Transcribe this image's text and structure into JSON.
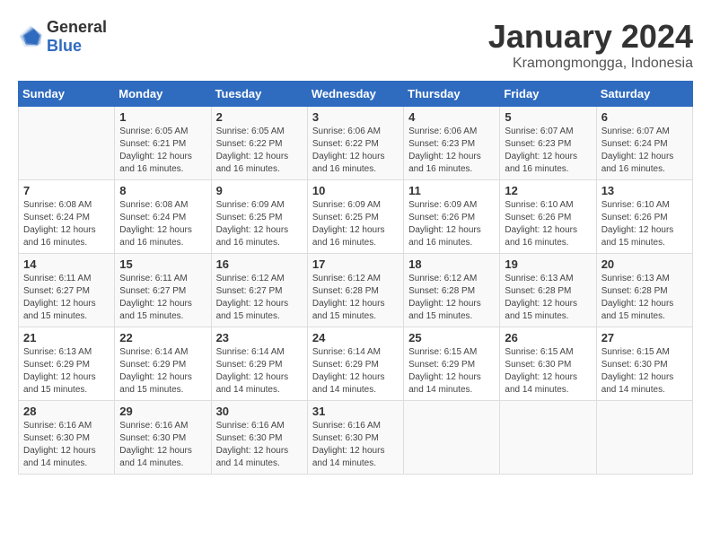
{
  "header": {
    "logo_general": "General",
    "logo_blue": "Blue",
    "month_year": "January 2024",
    "location": "Kramongmongga, Indonesia"
  },
  "weekdays": [
    "Sunday",
    "Monday",
    "Tuesday",
    "Wednesday",
    "Thursday",
    "Friday",
    "Saturday"
  ],
  "weeks": [
    [
      {
        "day": "",
        "info": ""
      },
      {
        "day": "1",
        "info": "Sunrise: 6:05 AM\nSunset: 6:21 PM\nDaylight: 12 hours\nand 16 minutes."
      },
      {
        "day": "2",
        "info": "Sunrise: 6:05 AM\nSunset: 6:22 PM\nDaylight: 12 hours\nand 16 minutes."
      },
      {
        "day": "3",
        "info": "Sunrise: 6:06 AM\nSunset: 6:22 PM\nDaylight: 12 hours\nand 16 minutes."
      },
      {
        "day": "4",
        "info": "Sunrise: 6:06 AM\nSunset: 6:23 PM\nDaylight: 12 hours\nand 16 minutes."
      },
      {
        "day": "5",
        "info": "Sunrise: 6:07 AM\nSunset: 6:23 PM\nDaylight: 12 hours\nand 16 minutes."
      },
      {
        "day": "6",
        "info": "Sunrise: 6:07 AM\nSunset: 6:24 PM\nDaylight: 12 hours\nand 16 minutes."
      }
    ],
    [
      {
        "day": "7",
        "info": "Sunrise: 6:08 AM\nSunset: 6:24 PM\nDaylight: 12 hours\nand 16 minutes."
      },
      {
        "day": "8",
        "info": "Sunrise: 6:08 AM\nSunset: 6:24 PM\nDaylight: 12 hours\nand 16 minutes."
      },
      {
        "day": "9",
        "info": "Sunrise: 6:09 AM\nSunset: 6:25 PM\nDaylight: 12 hours\nand 16 minutes."
      },
      {
        "day": "10",
        "info": "Sunrise: 6:09 AM\nSunset: 6:25 PM\nDaylight: 12 hours\nand 16 minutes."
      },
      {
        "day": "11",
        "info": "Sunrise: 6:09 AM\nSunset: 6:26 PM\nDaylight: 12 hours\nand 16 minutes."
      },
      {
        "day": "12",
        "info": "Sunrise: 6:10 AM\nSunset: 6:26 PM\nDaylight: 12 hours\nand 16 minutes."
      },
      {
        "day": "13",
        "info": "Sunrise: 6:10 AM\nSunset: 6:26 PM\nDaylight: 12 hours\nand 15 minutes."
      }
    ],
    [
      {
        "day": "14",
        "info": "Sunrise: 6:11 AM\nSunset: 6:27 PM\nDaylight: 12 hours\nand 15 minutes."
      },
      {
        "day": "15",
        "info": "Sunrise: 6:11 AM\nSunset: 6:27 PM\nDaylight: 12 hours\nand 15 minutes."
      },
      {
        "day": "16",
        "info": "Sunrise: 6:12 AM\nSunset: 6:27 PM\nDaylight: 12 hours\nand 15 minutes."
      },
      {
        "day": "17",
        "info": "Sunrise: 6:12 AM\nSunset: 6:28 PM\nDaylight: 12 hours\nand 15 minutes."
      },
      {
        "day": "18",
        "info": "Sunrise: 6:12 AM\nSunset: 6:28 PM\nDaylight: 12 hours\nand 15 minutes."
      },
      {
        "day": "19",
        "info": "Sunrise: 6:13 AM\nSunset: 6:28 PM\nDaylight: 12 hours\nand 15 minutes."
      },
      {
        "day": "20",
        "info": "Sunrise: 6:13 AM\nSunset: 6:28 PM\nDaylight: 12 hours\nand 15 minutes."
      }
    ],
    [
      {
        "day": "21",
        "info": "Sunrise: 6:13 AM\nSunset: 6:29 PM\nDaylight: 12 hours\nand 15 minutes."
      },
      {
        "day": "22",
        "info": "Sunrise: 6:14 AM\nSunset: 6:29 PM\nDaylight: 12 hours\nand 15 minutes."
      },
      {
        "day": "23",
        "info": "Sunrise: 6:14 AM\nSunset: 6:29 PM\nDaylight: 12 hours\nand 14 minutes."
      },
      {
        "day": "24",
        "info": "Sunrise: 6:14 AM\nSunset: 6:29 PM\nDaylight: 12 hours\nand 14 minutes."
      },
      {
        "day": "25",
        "info": "Sunrise: 6:15 AM\nSunset: 6:29 PM\nDaylight: 12 hours\nand 14 minutes."
      },
      {
        "day": "26",
        "info": "Sunrise: 6:15 AM\nSunset: 6:30 PM\nDaylight: 12 hours\nand 14 minutes."
      },
      {
        "day": "27",
        "info": "Sunrise: 6:15 AM\nSunset: 6:30 PM\nDaylight: 12 hours\nand 14 minutes."
      }
    ],
    [
      {
        "day": "28",
        "info": "Sunrise: 6:16 AM\nSunset: 6:30 PM\nDaylight: 12 hours\nand 14 minutes."
      },
      {
        "day": "29",
        "info": "Sunrise: 6:16 AM\nSunset: 6:30 PM\nDaylight: 12 hours\nand 14 minutes."
      },
      {
        "day": "30",
        "info": "Sunrise: 6:16 AM\nSunset: 6:30 PM\nDaylight: 12 hours\nand 14 minutes."
      },
      {
        "day": "31",
        "info": "Sunrise: 6:16 AM\nSunset: 6:30 PM\nDaylight: 12 hours\nand 14 minutes."
      },
      {
        "day": "",
        "info": ""
      },
      {
        "day": "",
        "info": ""
      },
      {
        "day": "",
        "info": ""
      }
    ]
  ]
}
